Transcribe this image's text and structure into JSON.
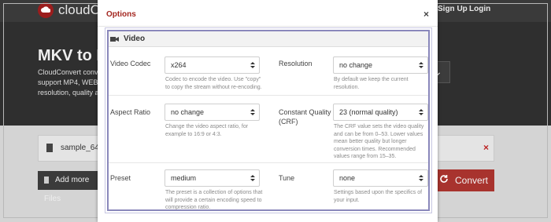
{
  "background": {
    "logo_text": "cloudC",
    "nav": {
      "signup": "Sign Up",
      "login": "Login"
    },
    "hero_title": "MKV to M",
    "hero_desc": [
      "CloudConvert conver",
      "support MP4, WEBM",
      "resolution, quality an"
    ],
    "hero_select_arrow": "⌄",
    "file_name": "sample_640x",
    "file_remove": "×",
    "add_more": "Add more Files",
    "convert": "Convert"
  },
  "modal": {
    "title": "Options",
    "close": "×",
    "section": "Video",
    "fields": {
      "video_codec": {
        "label": "Video Codec",
        "value": "x264",
        "help": "Codec to encode the video. Use \"copy\" to copy the stream without re-encoding."
      },
      "resolution": {
        "label": "Resolution",
        "value": "no change",
        "help": "By default we keep the current resolution."
      },
      "aspect_ratio": {
        "label": "Aspect Ratio",
        "value": "no change",
        "help": "Change the video aspect ratio, for example to 16:9 or 4:3."
      },
      "constant_quality": {
        "label": "Constant Quality (CRF)",
        "value": "23 (normal quality)",
        "help": "The CRF value sets the video quality and can be from 0–53. Lower values mean better quality but longer conversion times. Recommended values range from 15–35."
      },
      "preset": {
        "label": "Preset",
        "value": "medium",
        "help": "The preset is a collection of options that will provide a certain encoding speed to compression ratio."
      },
      "tune": {
        "label": "Tune",
        "value": "none",
        "help": "Settings based upon the specifics of your input."
      }
    }
  },
  "colors": {
    "accent": "#a3261f",
    "panel_border": "#8a88bb",
    "convert_bg": "#a8332e"
  }
}
